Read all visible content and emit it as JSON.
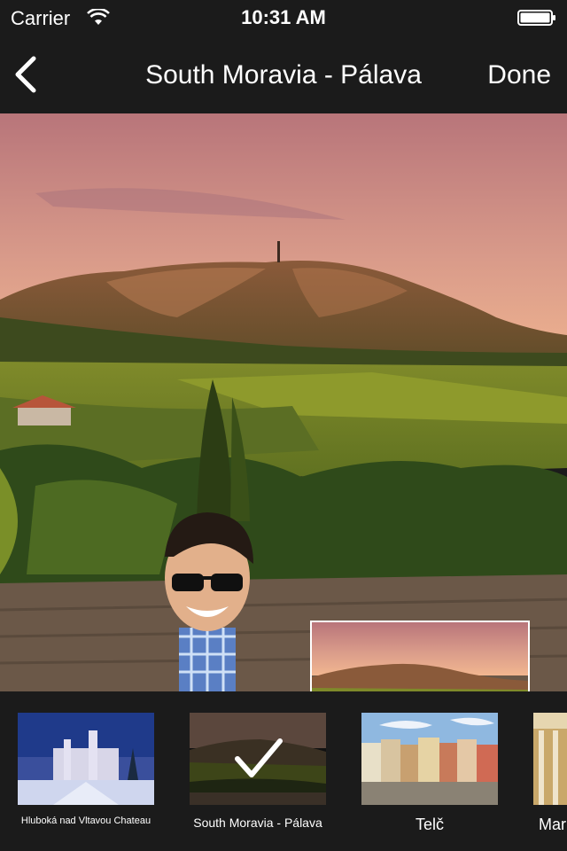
{
  "status_bar": {
    "carrier": "Carrier",
    "time": "10:31 AM"
  },
  "nav": {
    "title": "South Moravia - Pálava",
    "done_label": "Done",
    "back_icon": "chevron-left-icon"
  },
  "locations": [
    {
      "label": "Hluboká nad Vltavou Chateau",
      "selected": false
    },
    {
      "label": "South Moravia - Pálava",
      "selected": true
    },
    {
      "label": "Telč",
      "selected": false
    },
    {
      "label": "Mar",
      "selected": false
    }
  ],
  "colors": {
    "bar_background": "#1b1b1b",
    "text": "#ffffff",
    "sky_top": "#b8757a",
    "sky_bottom": "#f2b690"
  }
}
